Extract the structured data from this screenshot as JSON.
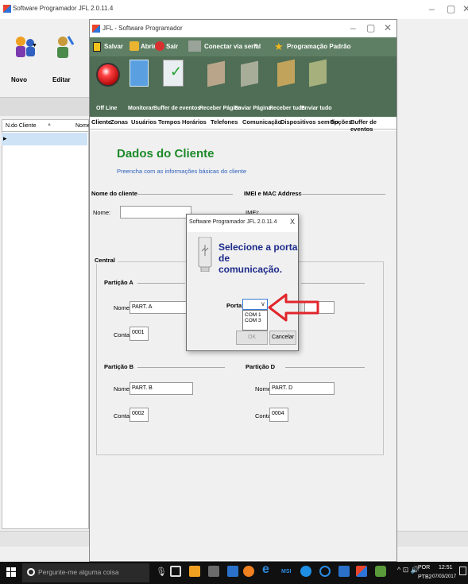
{
  "outer": {
    "title": "Software Programador JFL 2.0.11.4",
    "toolbar_new": "Novo",
    "toolbar_edit": "Editar",
    "grid_col1": "N.do Cliente",
    "grid_col2": "Nome"
  },
  "inner": {
    "title": "JFL - Software Programador",
    "menu": {
      "save": "Salvar",
      "open": "Abrir",
      "exit": "Sair",
      "connect": "Conectar via serial",
      "program_default": "Programação Padrão"
    },
    "ribbon": {
      "offline": "Off Line",
      "monitor": "Monitorar",
      "buffer": "Buffer de eventos",
      "receive_page": "Receber Página",
      "send_page": "Enviar Página",
      "receive_all": "Receber tudo",
      "send_all": "Enviar tudo"
    },
    "tabs": [
      "Cliente",
      "Zonas",
      "Usuários",
      "Tempos",
      "Horários",
      "Telefones",
      "Comunicação",
      "Dispositivos sem fio",
      "Opções",
      "Buffer de eventos"
    ]
  },
  "client": {
    "heading": "Dados do Cliente",
    "subtitle": "Preencha com as informações básicas do cliente",
    "name_group": "Nome do cliente",
    "name_label": "Nome:",
    "name_value": "",
    "imei_group": "IMEI e MAC Address",
    "imei_label": "IMEI:",
    "central_group": "Central",
    "partitions": {
      "a": {
        "title": "Partição A",
        "name_label": "Nome:",
        "name": "PART. A",
        "account_label": "Conta:",
        "account": "0001"
      },
      "b": {
        "title": "Partição B",
        "name_label": "Nome:",
        "name": "PART. B",
        "account_label": "Conta:",
        "account": "0002"
      },
      "d": {
        "title": "Partição D",
        "name_label": "Nome:",
        "name": "PART. D",
        "account_label": "Conta:",
        "account": "0004"
      }
    }
  },
  "dialog": {
    "title": "Software Programador JFL 2.0.11.4",
    "close": "X",
    "heading_line1": "Selecione a porta de",
    "heading_line2": "comunicação.",
    "port_label": "Porta:",
    "port_options": [
      "COM 1",
      "COM 3"
    ],
    "cancel": "Cancelar",
    "ok": "OK"
  },
  "taskbar": {
    "search_placeholder": "Pergunte-me alguma coisa",
    "lang": "POR",
    "layout": "PTB2",
    "time": "12:51",
    "date": "07/03/2017"
  },
  "colors": {
    "menu_bg": "#5e7f63",
    "ribbon_bg": "#4f6e55",
    "heading_green": "#1e8a2a",
    "hint_blue": "#2d5fbd",
    "arrow_red": "#e0262b"
  }
}
